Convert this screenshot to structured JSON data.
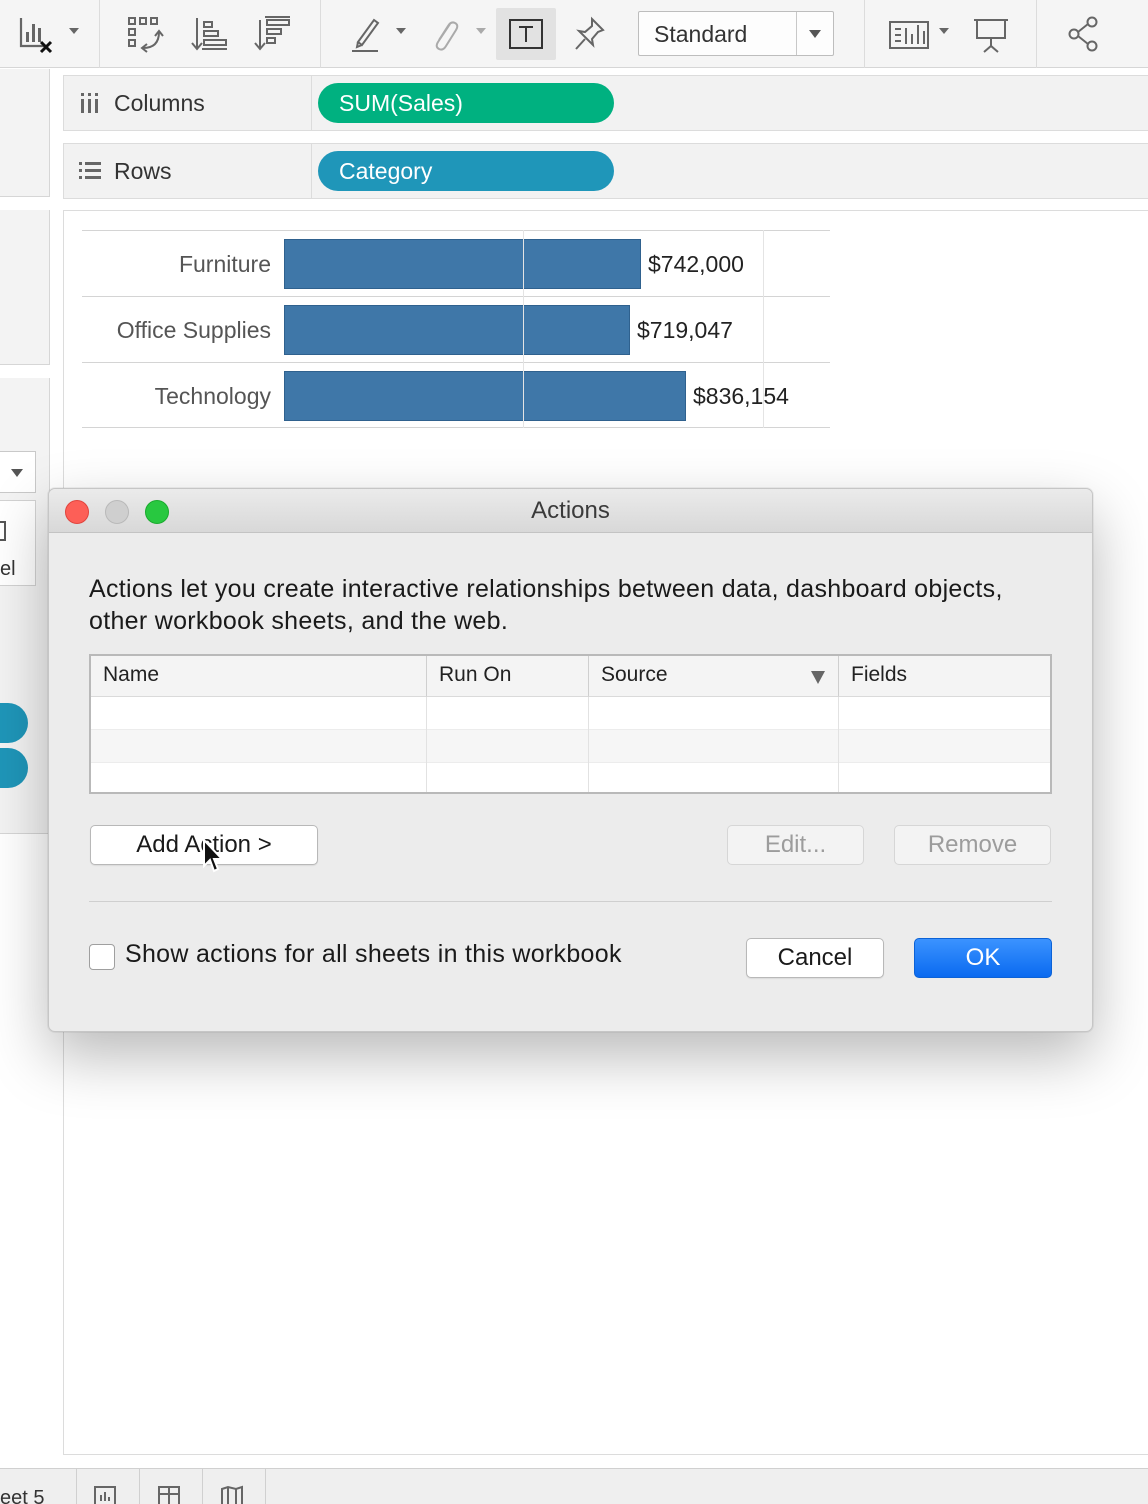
{
  "toolbar": {
    "icons": [
      "clear-sheet-icon",
      "swap-rows-columns-icon",
      "sort-ascending-icon",
      "sort-descending-icon",
      "highlight-icon",
      "group-paperclip-icon",
      "show-mark-labels-icon",
      "pin-axis-icon",
      "show-me-icon",
      "presentation-mode-icon",
      "share-icon"
    ],
    "fit_value": "Standard"
  },
  "shelves": {
    "columns": {
      "label": "Columns",
      "pill": "SUM(Sales)",
      "pill_color": "#00b180"
    },
    "rows": {
      "label": "Rows",
      "pill": "Category",
      "pill_color": "#1f96b9"
    }
  },
  "left_panel": {
    "partial_text": "el"
  },
  "chart_data": {
    "type": "bar",
    "orientation": "horizontal",
    "categories": [
      "Furniture",
      "Office Supplies",
      "Technology"
    ],
    "values": [
      742000,
      719047,
      836154
    ],
    "value_labels": [
      "$742,000",
      "$719,047",
      "$836,154"
    ],
    "bar_color": "#3f77a8",
    "xlim": [
      0,
      900000
    ],
    "xlabel": "",
    "ylabel": ""
  },
  "dialog": {
    "title": "Actions",
    "description": "Actions let you create interactive relationships between data, dashboard objects, other workbook sheets, and the web.",
    "table": {
      "columns": [
        "Name",
        "Run On",
        "Source",
        "Fields"
      ],
      "rows": []
    },
    "add_action_label": "Add Action >",
    "edit_label": "Edit...",
    "remove_label": "Remove",
    "show_all_label": "Show actions for all sheets in this workbook",
    "show_all_checked": false,
    "cancel_label": "Cancel",
    "ok_label": "OK",
    "ok_color": "#0a6af0"
  },
  "sheetbar": {
    "sheet_label": "eet 5",
    "icons": [
      "new-worksheet-icon",
      "new-dashboard-icon",
      "new-story-icon"
    ]
  }
}
